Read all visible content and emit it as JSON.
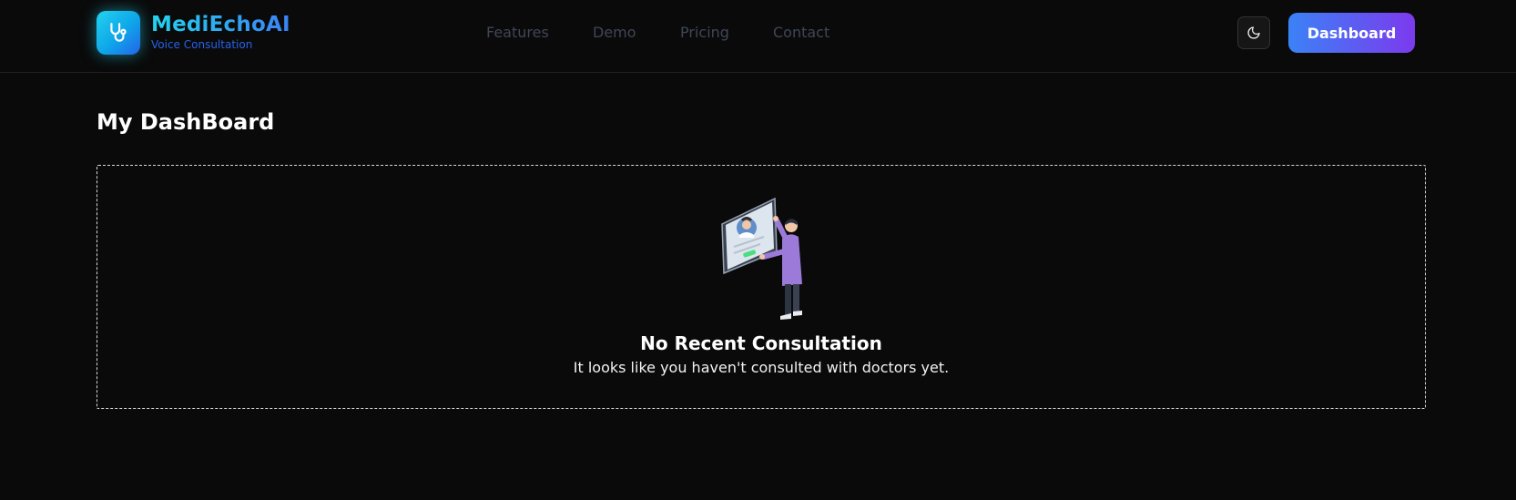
{
  "header": {
    "brand_name": "MediEchoAI",
    "brand_tagline": "Voice Consultation",
    "logo_icon": "stethoscope-icon",
    "nav": [
      {
        "label": "Features"
      },
      {
        "label": "Demo"
      },
      {
        "label": "Pricing"
      },
      {
        "label": "Contact"
      }
    ],
    "theme_toggle_icon": "moon-icon",
    "dashboard_button_label": "Dashboard"
  },
  "main": {
    "page_title": "My DashBoard",
    "empty_state": {
      "illustration": "doctor-tablet-illustration",
      "title": "No Recent Consultation",
      "description": "It looks like you haven't consulted with doctors yet."
    }
  },
  "colors": {
    "background": "#0a0a0a",
    "brand_cyan": "#22d3ee",
    "brand_blue": "#2563eb",
    "button_gradient_start": "#3b82f6",
    "button_gradient_end": "#7c3aed",
    "nav_link": "#3f4656"
  }
}
